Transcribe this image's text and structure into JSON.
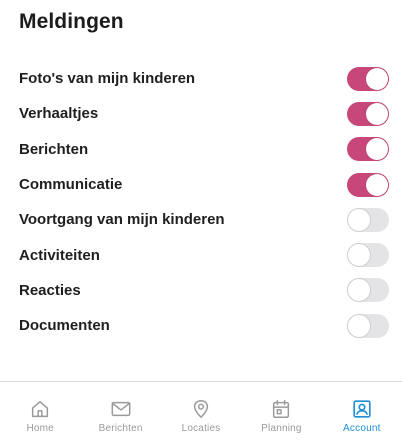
{
  "header": {
    "title": "Meldingen"
  },
  "settings": [
    {
      "label": "Foto's van mijn kinderen",
      "enabled": true
    },
    {
      "label": "Verhaaltjes",
      "enabled": true
    },
    {
      "label": "Berichten",
      "enabled": true
    },
    {
      "label": "Communicatie",
      "enabled": true
    },
    {
      "label": "Voortgang van mijn kinderen",
      "enabled": false
    },
    {
      "label": "Activiteiten",
      "enabled": false
    },
    {
      "label": "Reacties",
      "enabled": false
    },
    {
      "label": "Documenten",
      "enabled": false
    }
  ],
  "tabbar": {
    "active": "account",
    "tabs": [
      {
        "label": "Home",
        "icon": "home-icon"
      },
      {
        "label": "Berichten",
        "icon": "mail-icon"
      },
      {
        "label": "Locaties",
        "icon": "location-pin-icon"
      },
      {
        "label": "Planning",
        "icon": "calendar-icon"
      },
      {
        "label": "Account",
        "icon": "account-icon"
      }
    ]
  },
  "colors": {
    "toggle_on": "#c8477a",
    "toggle_off": "#e4e4e6",
    "tab_active": "#1e8fd2",
    "tab_inactive": "#9a9a9a"
  }
}
